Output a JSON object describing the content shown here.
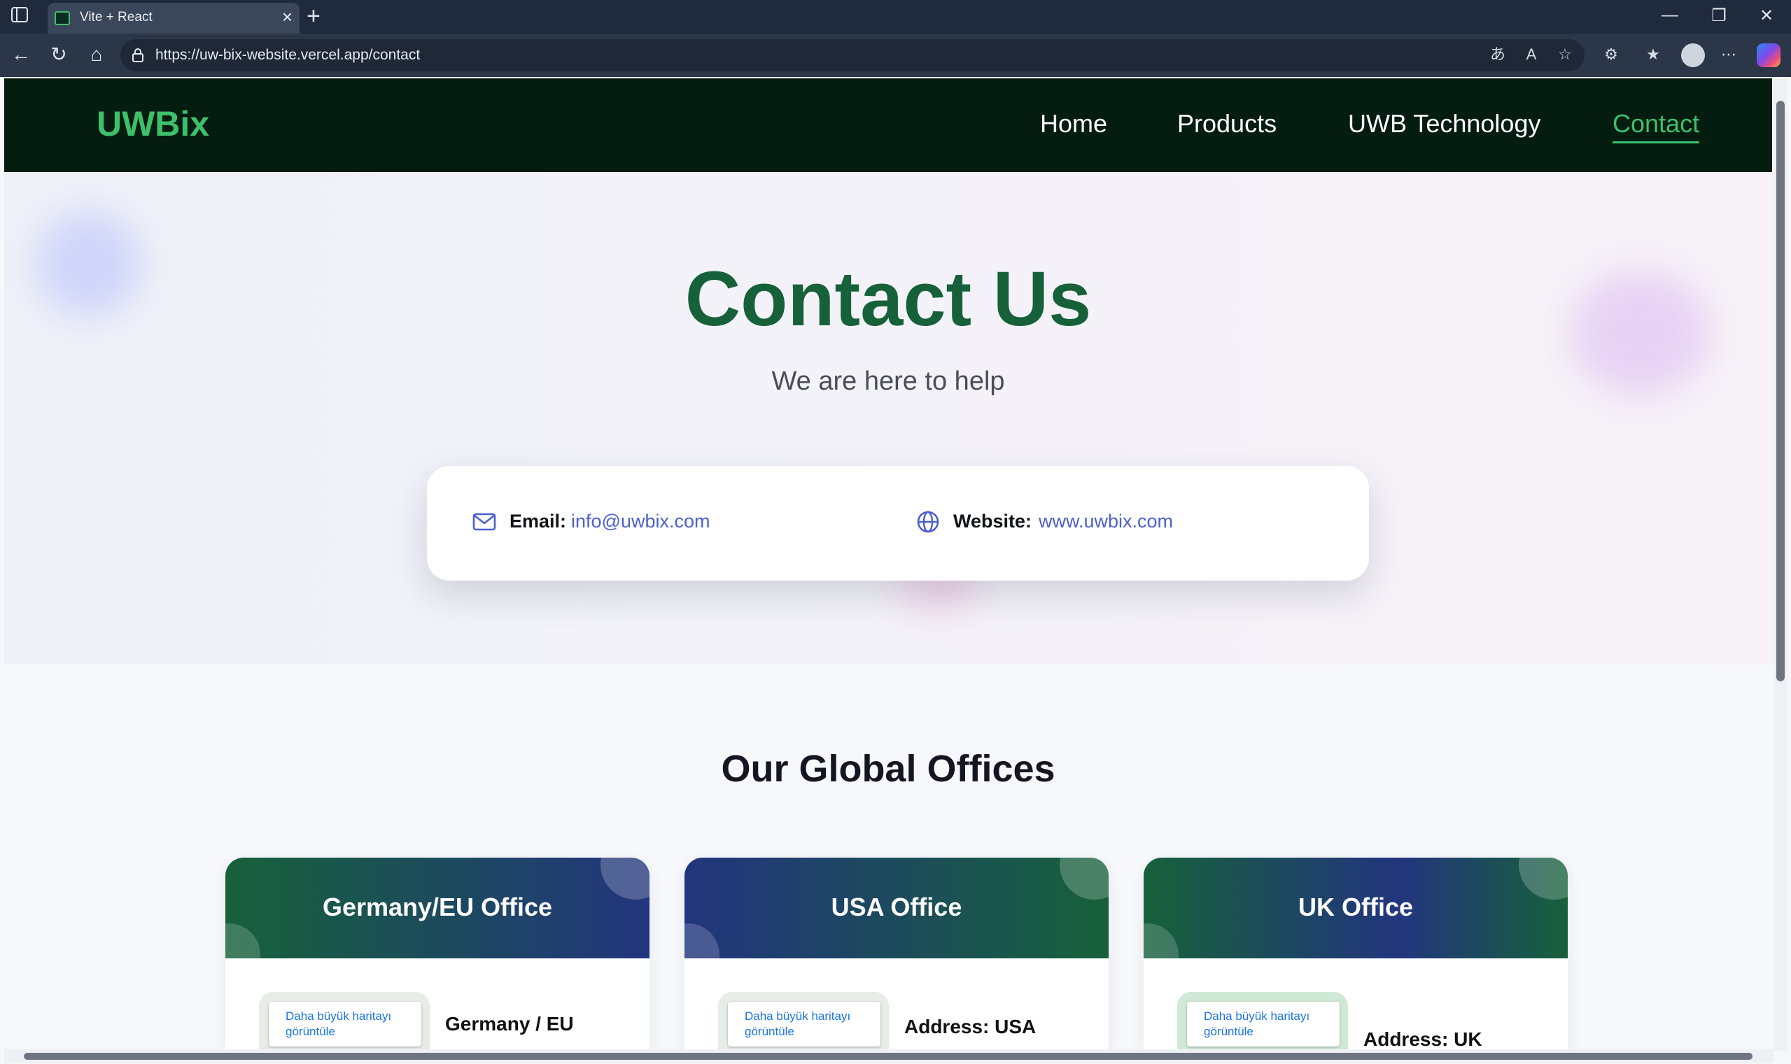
{
  "browser": {
    "tab_title": "Vite + React",
    "url": "https://uw-bix-website.vercel.app/contact",
    "tab_close": "×",
    "new_tab": "+",
    "window_buttons": {
      "minimize": "—",
      "restore": "❐",
      "close": "✕"
    }
  },
  "site": {
    "logo": "UWBix",
    "nav": [
      {
        "label": "Home"
      },
      {
        "label": "Products"
      },
      {
        "label": "UWB Technology"
      },
      {
        "label": "Contact",
        "active": true
      }
    ],
    "accent_color": "#3ec06b"
  },
  "hero": {
    "title": "Contact Us",
    "subtitle": "We are here to help"
  },
  "contact": {
    "email_label": "Email:",
    "email": "info@uwbix.com",
    "website_label": "Website:",
    "website": "www.uwbix.com"
  },
  "offices": {
    "title": "Our Global Offices",
    "cards": [
      {
        "title": "Germany/EU Office",
        "map_button": "Daha büyük haritayı görüntüle",
        "address": "Germany / EU"
      },
      {
        "title": "USA Office",
        "map_button": "Daha büyük haritayı görüntüle",
        "address": "Address: USA"
      },
      {
        "title": "UK Office",
        "map_button": "Daha büyük haritayı görüntüle",
        "address": "Address: UK"
      }
    ]
  }
}
